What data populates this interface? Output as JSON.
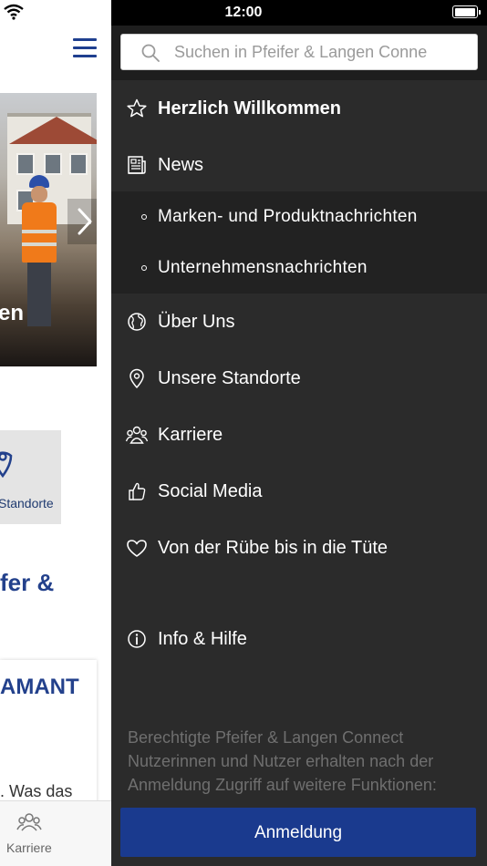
{
  "status_bar": {
    "time": "12:00"
  },
  "background_page": {
    "hero_caption_partial": "en",
    "tile_label_partial": "Standorte",
    "headline_partial": "fer &",
    "card_title_partial": "AMANT",
    "card_text_partial": ". Was das",
    "tabbar": {
      "active_tab_label": "Karriere"
    }
  },
  "drawer": {
    "search": {
      "placeholder": "Suchen in Pfeifer & Langen Conne"
    },
    "items": [
      {
        "label": "Herzlich Willkommen",
        "icon": "star-icon"
      },
      {
        "label": "News",
        "icon": "newspaper-icon"
      },
      {
        "label": "Über Uns",
        "icon": "globe-icon"
      },
      {
        "label": "Unsere Standorte",
        "icon": "location-pin-icon"
      },
      {
        "label": "Karriere",
        "icon": "people-group-icon"
      },
      {
        "label": "Social Media",
        "icon": "thumbs-up-icon"
      },
      {
        "label": "Von der Rübe bis in die Tüte",
        "icon": "heart-icon"
      },
      {
        "label": "Info & Hilfe",
        "icon": "info-icon"
      }
    ],
    "news_subitems": [
      {
        "label": "Marken- und Produktnachrichten"
      },
      {
        "label": "Unternehmensnachrichten"
      }
    ],
    "login_note": "Berechtigte Pfeifer & Langen Connect Nutzerinnen und Nutzer erhalten nach der Anmeldung Zugriff auf weitere Funktionen:",
    "login_button_label": "Anmeldung"
  },
  "colors": {
    "drawer_background": "#2b2b2b",
    "submenu_background": "#222222",
    "accent_blue": "#1a3a8e",
    "headline_blue": "#23418c"
  }
}
